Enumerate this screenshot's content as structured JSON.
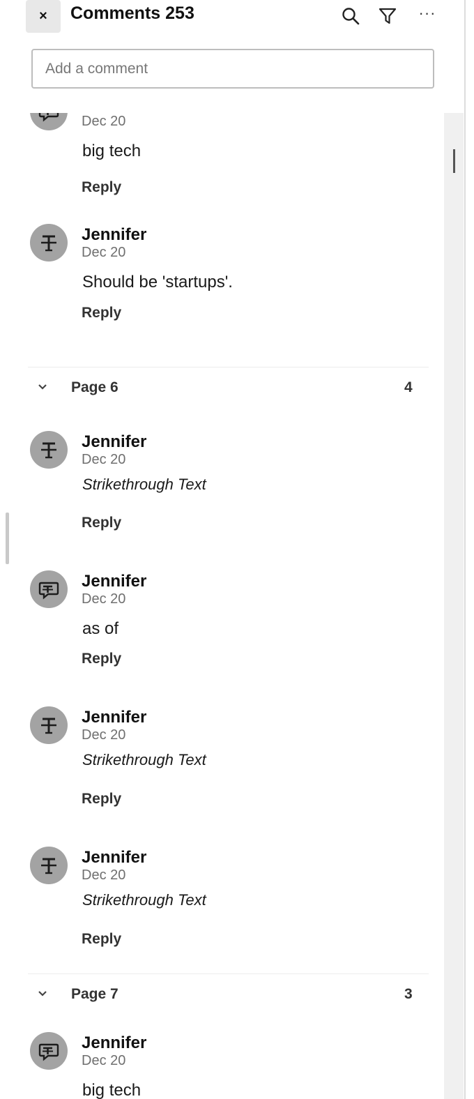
{
  "header": {
    "close_label": "×",
    "title": "Comments 253",
    "more_label": "···"
  },
  "add_comment": {
    "placeholder": "Add a comment"
  },
  "reply_label": "Reply",
  "comments_pre": [
    {
      "author": "",
      "date": "Dec 20",
      "text": "big tech",
      "icon": "comment-bubble-icon"
    },
    {
      "author": "Jennifer",
      "date": "Dec 20",
      "text": "Should be 'startups'.",
      "icon": "strikethrough-icon"
    }
  ],
  "groups": [
    {
      "title": "Page 6",
      "count": "4",
      "comments": [
        {
          "author": "Jennifer",
          "date": "Dec 20",
          "text": "Strikethrough Text",
          "italic": true,
          "icon": "strikethrough-icon"
        },
        {
          "author": "Jennifer",
          "date": "Dec 20",
          "text": "as of",
          "italic": false,
          "icon": "comment-bubble-icon"
        },
        {
          "author": "Jennifer",
          "date": "Dec 20",
          "text": "Strikethrough Text",
          "italic": true,
          "icon": "strikethrough-icon"
        },
        {
          "author": "Jennifer",
          "date": "Dec 20",
          "text": "Strikethrough Text",
          "italic": true,
          "icon": "strikethrough-icon"
        }
      ]
    },
    {
      "title": "Page 7",
      "count": "3",
      "comments": [
        {
          "author": "Jennifer",
          "date": "Dec 20",
          "text": "big tech",
          "italic": false,
          "icon": "comment-bubble-icon"
        }
      ]
    }
  ]
}
